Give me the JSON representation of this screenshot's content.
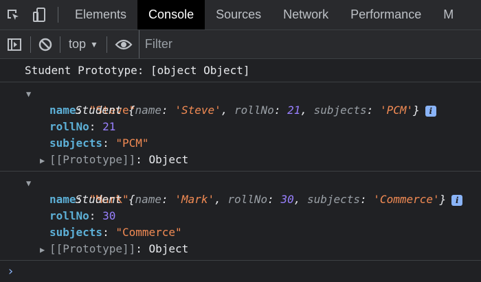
{
  "tabs": [
    "Elements",
    "Console",
    "Sources",
    "Network",
    "Performance",
    "M"
  ],
  "toolbar": {
    "context": "top",
    "filter_placeholder": "Filter"
  },
  "console": {
    "line1": "Student Prototype: [object Object]",
    "objects": [
      {
        "class_name": "Student",
        "preview": {
          "name": "'Steve'",
          "rollNo": "21",
          "subjects": "'PCM'"
        },
        "props": {
          "name": "\"Steve\"",
          "rollNo": "21",
          "subjects": "\"PCM\""
        },
        "proto_label": "[[Prototype]]",
        "proto_value": "Object"
      },
      {
        "class_name": "Student",
        "preview": {
          "name": "'Mark'",
          "rollNo": "30",
          "subjects": "'Commerce'"
        },
        "props": {
          "name": "\"Mark\"",
          "rollNo": "30",
          "subjects": "\"Commerce\""
        },
        "proto_label": "[[Prototype]]",
        "proto_value": "Object"
      }
    ],
    "prompt_symbol": "›"
  },
  "colors": {
    "background": "#202124",
    "key": "#5db0d7",
    "string": "#f28b54",
    "number": "#9980ff",
    "prompt": "#8ab4f8"
  },
  "icons": [
    "inspect-icon",
    "device-toggle-icon",
    "sidebar-toggle-icon",
    "clear-console-icon",
    "eye-icon",
    "info-icon",
    "expand-triangle-icon",
    "prompt-chevron-icon"
  ]
}
